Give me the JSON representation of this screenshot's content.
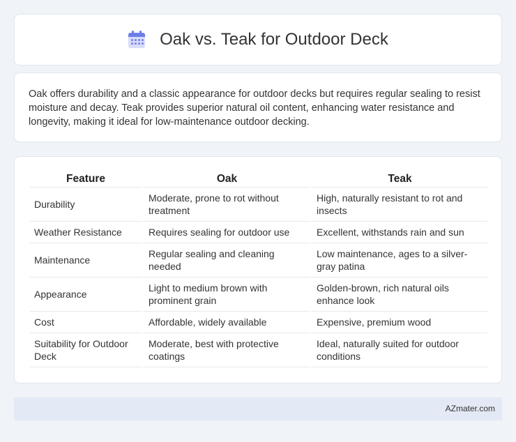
{
  "header": {
    "title": "Oak vs. Teak for Outdoor Deck",
    "icon": "calendar-icon"
  },
  "summary": {
    "text": "Oak offers durability and a classic appearance for outdoor decks but requires regular sealing to resist moisture and decay. Teak provides superior natural oil content, enhancing water resistance and longevity, making it ideal for low-maintenance outdoor decking."
  },
  "table": {
    "headers": [
      "Feature",
      "Oak",
      "Teak"
    ],
    "rows": [
      [
        "Durability",
        "Moderate, prone to rot without treatment",
        "High, naturally resistant to rot and insects"
      ],
      [
        "Weather Resistance",
        "Requires sealing for outdoor use",
        "Excellent, withstands rain and sun"
      ],
      [
        "Maintenance",
        "Regular sealing and cleaning needed",
        "Low maintenance, ages to a silver-gray patina"
      ],
      [
        "Appearance",
        "Light to medium brown with prominent grain",
        "Golden-brown, rich natural oils enhance look"
      ],
      [
        "Cost",
        "Affordable, widely available",
        "Expensive, premium wood"
      ],
      [
        "Suitability for Outdoor Deck",
        "Moderate, best with protective coatings",
        "Ideal, naturally suited for outdoor conditions"
      ]
    ]
  },
  "footer": {
    "brand": "AZmater.com"
  },
  "colors": {
    "background": "#f0f3f8",
    "card": "#ffffff",
    "footer": "#e3e9f5",
    "icon_accent": "#6e7ee8"
  }
}
